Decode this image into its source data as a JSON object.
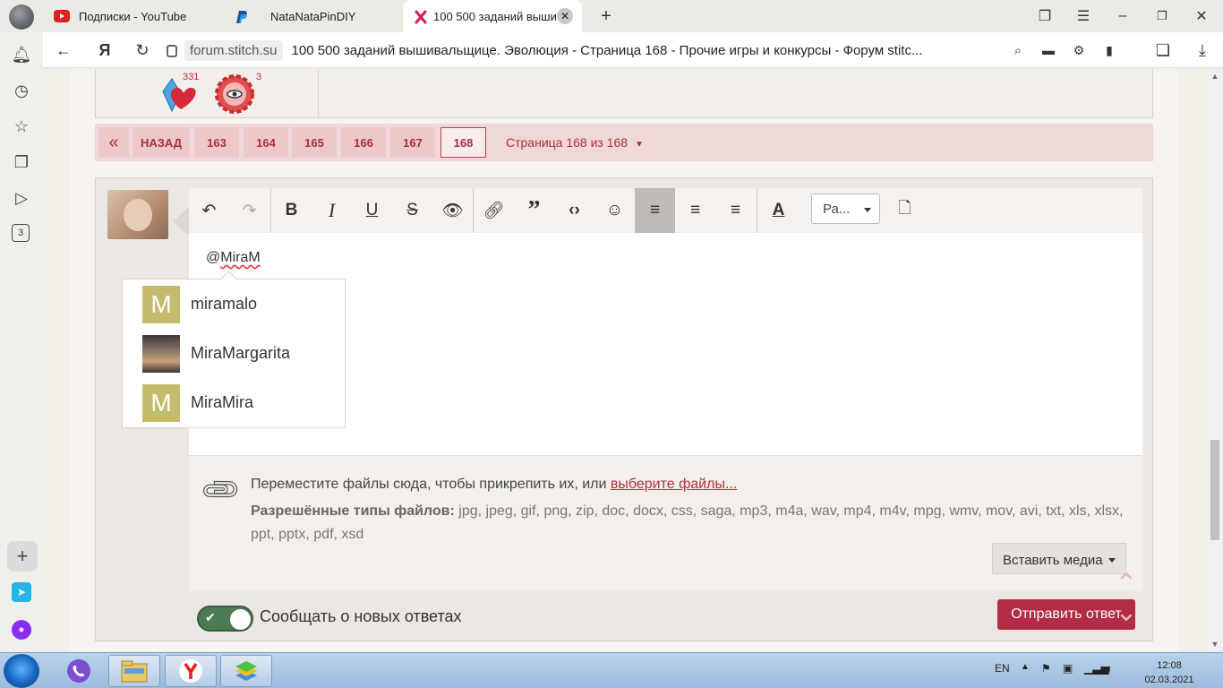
{
  "browser": {
    "tabs": [
      {
        "label": "Подписки - YouTube"
      },
      {
        "label": "NataNataPinDIY"
      },
      {
        "label": "100 500 заданий выши"
      }
    ],
    "url_domain": "forum.stitch.su",
    "page_title": "100 500 заданий вышивальщице. Эволюция - Страница 168 - Прочие игры и конкурсы - Форум stitc...",
    "sidebar_badge": "3",
    "colors": {
      "accent": "#b32c45",
      "pagenav_bg": "#f1d8d8"
    }
  },
  "reactions": [
    {
      "icon": "heart-diamond-icon",
      "count": "331"
    },
    {
      "icon": "gear-eye-icon",
      "count": "3"
    }
  ],
  "pagination": {
    "first_icon": "«",
    "back_label": "НАЗАД",
    "pages": [
      "163",
      "164",
      "165",
      "166",
      "167"
    ],
    "current": "168",
    "info": "Страница 168 из 168"
  },
  "editor": {
    "toolbar": {
      "undo": "undo-icon",
      "redo": "redo-icon",
      "bold": "B",
      "italic": "I",
      "underline": "U",
      "strike": "S",
      "font_select": "Ра..."
    },
    "text_prefix": "@",
    "text_mention": "MiraM"
  },
  "mention_suggestions": [
    {
      "initial": "M",
      "name": "miramalo"
    },
    {
      "initial": "",
      "name": "MiraMargarita"
    },
    {
      "initial": "M",
      "name": "MiraMira"
    }
  ],
  "attachments": {
    "prompt": "Переместите файлы сюда, чтобы прикрепить их, или ",
    "link": "выберите файлы...",
    "types_label": "Разрешённые типы файлов:",
    "types": " jpg, jpeg, gif, png, zip, doc, docx, css, saga, mp3, m4a, wav, mp4, m4v, mpg, wmv, mov, avi, txt, xls, xlsx, ppt, pptx, pdf, xsd",
    "insert_media": "Вставить медиа"
  },
  "notify_label": "Сообщать о новых ответах",
  "submit_label": "Отправить ответ",
  "taskbar": {
    "lang": "EN",
    "time": "12:08",
    "date": "02.03.2021"
  }
}
